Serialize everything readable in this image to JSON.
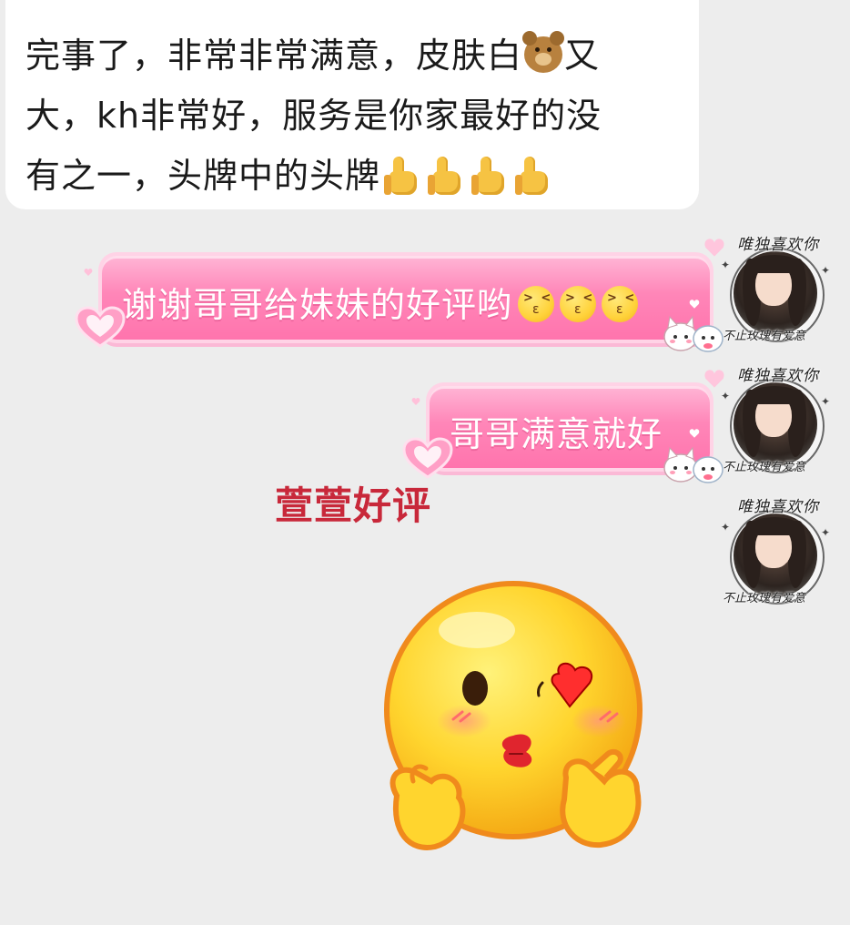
{
  "chat": {
    "incoming": {
      "lines": [
        "完事了，非常非常满意，皮肤白",
        "又",
        "大，kh非常好，服务是你家最好的没",
        "有之一，头牌中的头牌"
      ],
      "emoji_after_line1": "bear-face",
      "emoji_after_line3": [
        "thumbs-up",
        "thumbs-up",
        "thumbs-up",
        "thumbs-up"
      ]
    },
    "outgoing": [
      {
        "text": "谢谢哥哥给妹妹的好评哟",
        "emojis": [
          "kissing-face",
          "kissing-face",
          "kissing-face"
        ]
      },
      {
        "text": "哥哥满意就好",
        "emojis": []
      }
    ],
    "avatar": {
      "top_text": "唯独喜欢你",
      "bottom_text": "不止玫瑰有爱意"
    }
  },
  "caption": "萱萱好评",
  "colors": {
    "background": "#ededed",
    "bubble_pink": "#ff86b8",
    "caption_red": "#c8283a"
  }
}
